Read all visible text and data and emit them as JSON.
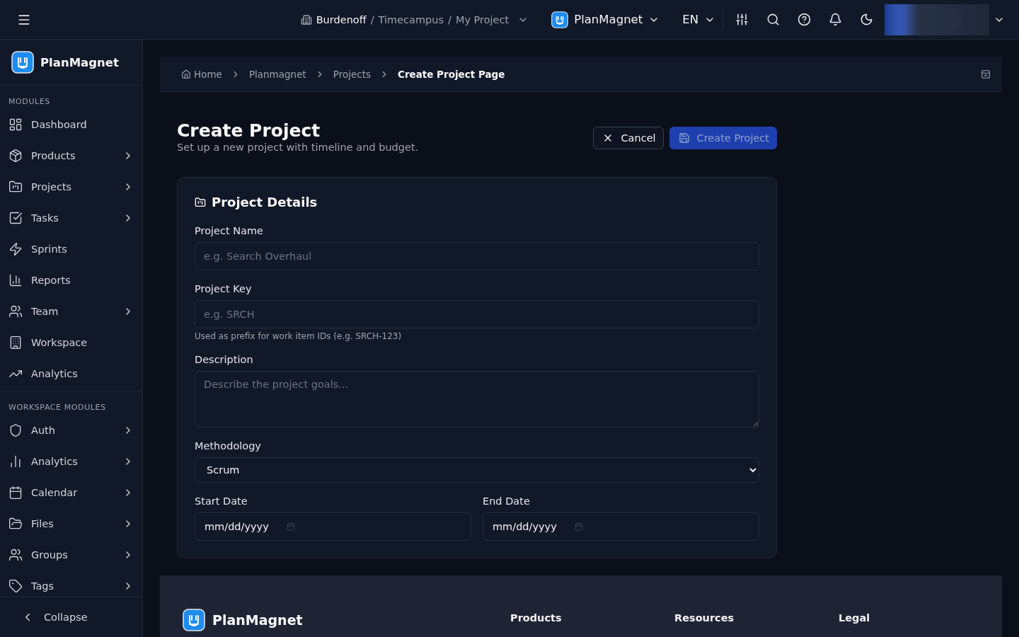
{
  "topbar": {
    "context": {
      "segments": [
        "Burdenoff",
        "Timecampus",
        "My Project"
      ],
      "separator": "/"
    },
    "app_switcher": "PlanMagnet",
    "language": "EN"
  },
  "sidebar": {
    "brand": "PlanMagnet",
    "sections": [
      {
        "title": "MODULES",
        "items": [
          {
            "label": "Dashboard",
            "expandable": false
          },
          {
            "label": "Products",
            "expandable": true
          },
          {
            "label": "Projects",
            "expandable": true
          },
          {
            "label": "Tasks",
            "expandable": true
          },
          {
            "label": "Sprints",
            "expandable": false
          },
          {
            "label": "Reports",
            "expandable": false
          },
          {
            "label": "Team",
            "expandable": true
          },
          {
            "label": "Workspace",
            "expandable": false
          },
          {
            "label": "Analytics",
            "expandable": false
          }
        ]
      },
      {
        "title": "WORKSPACE MODULES",
        "items": [
          {
            "label": "Auth",
            "expandable": true
          },
          {
            "label": "Analytics",
            "expandable": true
          },
          {
            "label": "Calendar",
            "expandable": true
          },
          {
            "label": "Files",
            "expandable": true
          },
          {
            "label": "Groups",
            "expandable": true
          },
          {
            "label": "Tags",
            "expandable": true
          }
        ]
      }
    ],
    "collapse": "Collapse"
  },
  "breadcrumb": [
    {
      "label": "Home",
      "current": false
    },
    {
      "label": "Planmagnet",
      "current": false
    },
    {
      "label": "Projects",
      "current": false
    },
    {
      "label": "Create Project Page",
      "current": true
    }
  ],
  "page": {
    "title": "Create Project",
    "subtitle": "Set up a new project with timeline and budget.",
    "buttons": [
      {
        "kind": "secondary",
        "label": "Cancel",
        "disabled": false
      },
      {
        "kind": "primary",
        "label": "Create Project",
        "disabled": true
      }
    ]
  },
  "card": {
    "title": "Project Details",
    "fields": [
      {
        "kind": "text",
        "label": "Project Name",
        "placeholder": "e.g. Search Overhaul"
      },
      {
        "kind": "text",
        "label": "Project Key",
        "placeholder": "e.g. SRCH",
        "hint": "Used as prefix for work item IDs (e.g. SRCH-123)"
      },
      {
        "kind": "textarea",
        "label": "Description",
        "placeholder": "Describe the project goals..."
      },
      {
        "kind": "select",
        "label": "Methodology",
        "value": "Scrum"
      }
    ],
    "dates": [
      {
        "label": "Start Date",
        "placeholder": "mm/dd/yyyy"
      },
      {
        "label": "End Date",
        "placeholder": "mm/dd/yyyy"
      }
    ]
  },
  "footer": {
    "brand": "PlanMagnet",
    "columns": [
      "Products",
      "Resources",
      "Legal"
    ]
  }
}
